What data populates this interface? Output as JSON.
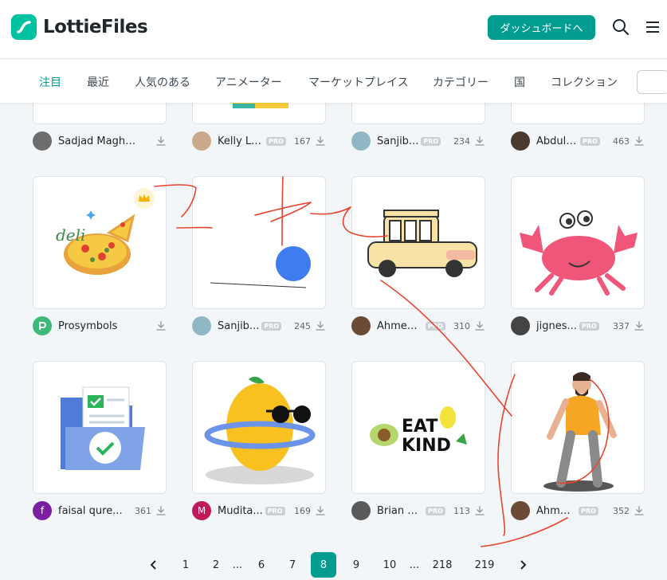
{
  "header": {
    "logo_text": "LottieFiles",
    "dashboard_button": "ダッシュボードへ"
  },
  "tabs": [
    "注目",
    "最近",
    "人気のある",
    "アニメーター",
    "マーケットプレイス",
    "カテゴリー",
    "国",
    "コレクション"
  ],
  "rows": [
    {
      "items": [
        {
          "author": "Sadjad Maghs...",
          "pro": false,
          "count": ""
        },
        {
          "author": "Kelly Lo...",
          "pro": true,
          "pro_label": "PRO",
          "count": "167"
        },
        {
          "author": "Sanjib...",
          "pro": true,
          "pro_label": "PRO",
          "count": "234"
        },
        {
          "author": "Abdul ...",
          "pro": true,
          "pro_label": "PRO",
          "count": "463"
        }
      ]
    },
    {
      "items": [
        {
          "author": "Prosymbols",
          "pro": false,
          "count": ""
        },
        {
          "author": "Sanjib...",
          "pro": true,
          "pro_label": "PRO",
          "count": "245"
        },
        {
          "author": "Ahmed...",
          "pro": true,
          "pro_label": "PRO",
          "count": "310"
        },
        {
          "author": "jignes...",
          "pro": true,
          "pro_label": "PRO",
          "count": "337"
        }
      ]
    },
    {
      "items": [
        {
          "author": "faisal qure...",
          "pro": false,
          "count": "361",
          "avatar_letter": "f"
        },
        {
          "author": "Mudita...",
          "pro": true,
          "pro_label": "PRO",
          "count": "169",
          "avatar_letter": "M"
        },
        {
          "author": "Brian K...",
          "pro": true,
          "pro_label": "PRO",
          "count": "113"
        },
        {
          "author": "Ahme...",
          "pro": true,
          "pro_label": "PRO",
          "count": "352"
        }
      ]
    }
  ],
  "card_art": {
    "eat_kind_text_1": "EAT",
    "eat_kind_text_2": "KIND",
    "deli_text": "deli"
  },
  "pagination": {
    "pages": [
      "1",
      "2",
      "...",
      "6",
      "7",
      "8",
      "9",
      "10",
      "...",
      "218",
      "219"
    ],
    "current": "8"
  },
  "colors": {
    "brand": "#00c1a2",
    "accent": "#019d91",
    "annotation": "#e8452c"
  }
}
